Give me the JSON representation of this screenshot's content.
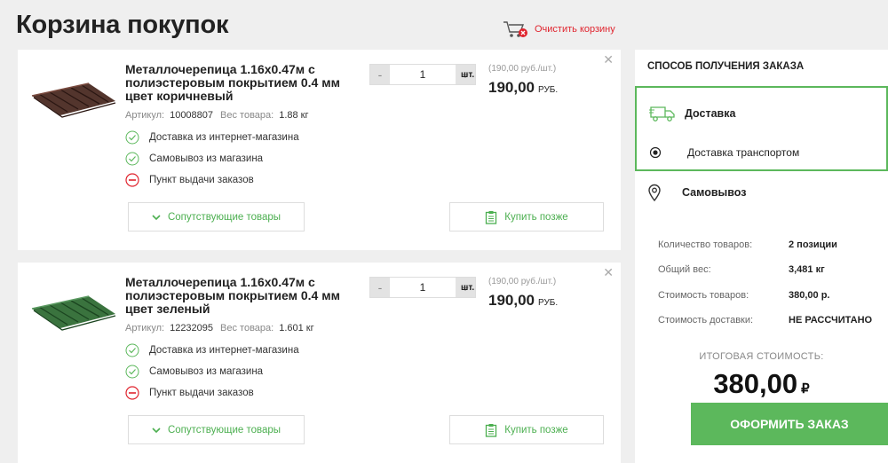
{
  "page": {
    "title": "Корзина покупок",
    "clear_cart": "Очистить корзину"
  },
  "products": [
    {
      "title": "Металлочерепица 1.16x0.47м с полиэстеровым покрытием 0.4 мм цвет коричневый",
      "article_label": "Артикул:",
      "article": "10008807",
      "weight_label": "Вес товара:",
      "weight": "1.88 кг",
      "qty": "1",
      "unit": "шт.",
      "unit_price": "(190,00 руб./шт.)",
      "price": "190,00",
      "currency": "РУБ.",
      "availability": [
        {
          "label": "Доставка из интернет-магазина",
          "status": "available"
        },
        {
          "label": "Самовывоз из магазина",
          "status": "available"
        },
        {
          "label": "Пункт выдачи заказов",
          "status": "unavailable"
        }
      ],
      "related_label": "Сопутствующие товары",
      "later_label": "Купить позже",
      "color": "#4a2a22"
    },
    {
      "title": "Металлочерепица 1.16x0.47м с полиэстеровым покрытием 0.4 мм цвет зеленый",
      "article_label": "Артикул:",
      "article": "12232095",
      "weight_label": "Вес товара:",
      "weight": "1.601 кг",
      "qty": "1",
      "unit": "шт.",
      "unit_price": "(190,00 руб./шт.)",
      "price": "190,00",
      "currency": "РУБ.",
      "availability": [
        {
          "label": "Доставка из интернет-магазина",
          "status": "available"
        },
        {
          "label": "Самовывоз из магазина",
          "status": "available"
        },
        {
          "label": "Пункт выдачи заказов",
          "status": "unavailable"
        }
      ],
      "related_label": "Сопутствующие товары",
      "later_label": "Купить позже",
      "color": "#2f6b34"
    }
  ],
  "sidebar": {
    "heading": "СПОСОБ ПОЛУЧЕНИЯ ЗАКАЗА",
    "delivery": {
      "label": "Доставка",
      "sub_option": "Доставка транспортом",
      "selected": true
    },
    "pickup": {
      "label": "Самовывоз"
    },
    "summary": [
      {
        "label": "Количество товаров:",
        "value": "2 позиции"
      },
      {
        "label": "Общий вес:",
        "value": "3,481 кг"
      },
      {
        "label": "Стоимость товаров:",
        "value": "380,00 р."
      },
      {
        "label": "Стоимость доставки:",
        "value": "НЕ РАССЧИТАНО"
      }
    ],
    "total_label": "ИТОГОВАЯ СТОИМОСТЬ:",
    "total": "380,00",
    "total_currency": "₽",
    "checkout_label": "ОФОРМИТЬ ЗАКАЗ"
  },
  "colors": {
    "accent": "#5cb85c",
    "danger": "#e0242e"
  }
}
